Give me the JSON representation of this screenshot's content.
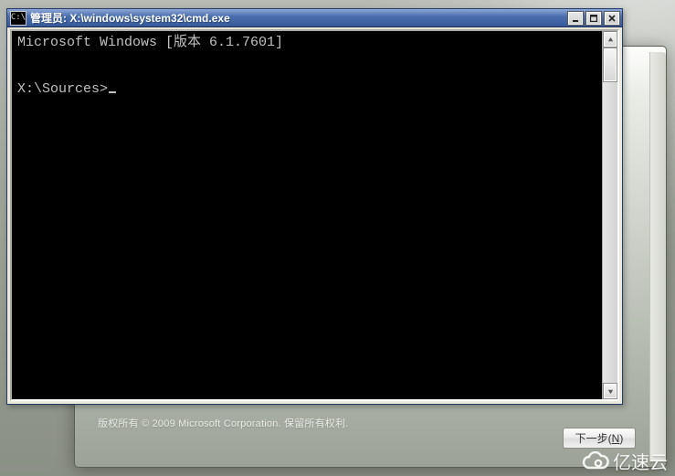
{
  "installer": {
    "copyright": "版权所有 © 2009 Microsoft Corporation. 保留所有权利.",
    "next_label": "下一步",
    "next_hotkey": "N"
  },
  "cmd": {
    "title": "管理员: X:\\windows\\system32\\cmd.exe",
    "icon_text": "C:\\",
    "lines": {
      "l1": "Microsoft Windows [版本 6.1.7601]",
      "l2": "",
      "l3": "",
      "prompt": "X:\\Sources>"
    }
  },
  "watermark": "亿速云"
}
